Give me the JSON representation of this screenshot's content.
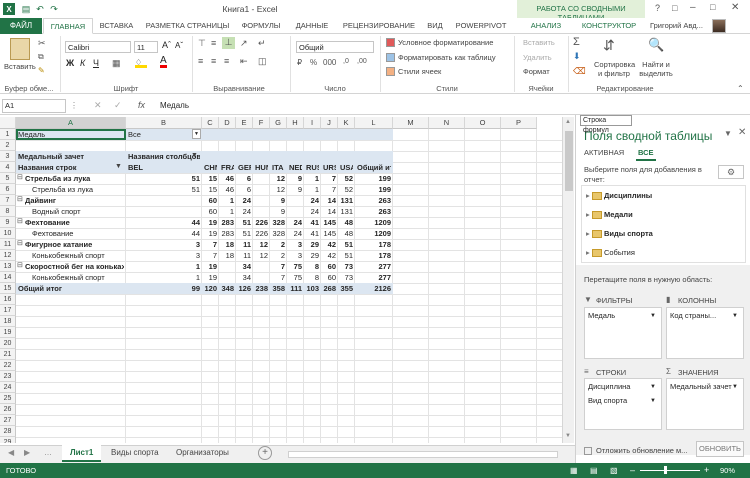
{
  "app": {
    "title": "Книга1 - Excel",
    "context_tab": "РАБОТА СО СВОДНЫМИ ТАБЛИЦАМИ",
    "user": "Григорий Авд..."
  },
  "tabs": [
    "ФАЙЛ",
    "ГЛАВНАЯ",
    "ВСТАВКА",
    "РАЗМЕТКА СТРАНИЦЫ",
    "ФОРМУЛЫ",
    "ДАННЫЕ",
    "РЕЦЕНЗИРОВАНИЕ",
    "ВИД",
    "POWERPIVOT",
    "АНАЛИЗ",
    "КОНСТРУКТОР"
  ],
  "ribbon": {
    "paste": "Вставить",
    "font_name": "Calibri",
    "font_size": "11",
    "number_format": "Общий",
    "cond_format": "Условное форматирование",
    "format_table": "Форматировать как таблицу",
    "cell_styles": "Стили ячеек",
    "insert": "Вставить",
    "delete": "Удалить",
    "format": "Формат",
    "sort": "Сортировка и фильтр",
    "find": "Найти и выделить",
    "groups": [
      "Буфер обме...",
      "Шрифт",
      "Выравнивание",
      "Число",
      "Стили",
      "Ячейки",
      "Редактирование"
    ]
  },
  "formula_bar": {
    "name_box": "A1",
    "fx": "fx",
    "value": "Медаль",
    "tooltip": "Строка формул"
  },
  "columns": [
    "A",
    "B",
    "C",
    "D",
    "E",
    "F",
    "G",
    "H",
    "I",
    "J",
    "K",
    "L",
    "M",
    "N",
    "O",
    "P"
  ],
  "rows": [
    {
      "n": "1",
      "a": "Медаль",
      "b": "Все"
    },
    {
      "n": "2"
    },
    {
      "n": "3",
      "a": "Медальный зачет",
      "b": "Названия столбцов"
    },
    {
      "n": "4",
      "a": "Названия строк",
      "b": "BEL",
      "vals": [
        "CHN",
        "FRA",
        "GER",
        "HUN",
        "ITA",
        "NED",
        "RUS",
        "URS",
        "USA",
        "Общий итог"
      ]
    },
    {
      "n": "5",
      "a": "Стрельба из лука",
      "vals": [
        "51",
        "15",
        "46",
        "6",
        "",
        "12",
        "9",
        "1",
        "7",
        "52",
        "199"
      ]
    },
    {
      "n": "6",
      "a": "Стрельба из лука",
      "vals": [
        "51",
        "15",
        "46",
        "6",
        "",
        "12",
        "9",
        "1",
        "7",
        "52",
        "199"
      ]
    },
    {
      "n": "7",
      "a": "Дайвинг",
      "vals": [
        "",
        "60",
        "1",
        "24",
        "",
        "9",
        "",
        "24",
        "14",
        "131",
        "263"
      ]
    },
    {
      "n": "8",
      "a": "Водный спорт",
      "vals": [
        "",
        "60",
        "1",
        "24",
        "",
        "9",
        "",
        "24",
        "14",
        "131",
        "263"
      ]
    },
    {
      "n": "9",
      "a": "Фехтование",
      "vals": [
        "44",
        "19",
        "283",
        "51",
        "226",
        "328",
        "24",
        "41",
        "145",
        "48",
        "1209"
      ]
    },
    {
      "n": "10",
      "a": "Фехтование",
      "vals": [
        "44",
        "19",
        "283",
        "51",
        "226",
        "328",
        "24",
        "41",
        "145",
        "48",
        "1209"
      ]
    },
    {
      "n": "11",
      "a": "Фигурное катание",
      "vals": [
        "3",
        "7",
        "18",
        "11",
        "12",
        "2",
        "3",
        "29",
        "42",
        "51",
        "178"
      ]
    },
    {
      "n": "12",
      "a": "Конькобежный спорт",
      "vals": [
        "3",
        "7",
        "18",
        "11",
        "12",
        "2",
        "3",
        "29",
        "42",
        "51",
        "178"
      ]
    },
    {
      "n": "13",
      "a": "Скоростной бег на коньках",
      "vals": [
        "1",
        "19",
        "",
        "34",
        "",
        "7",
        "75",
        "8",
        "60",
        "73",
        "277"
      ]
    },
    {
      "n": "14",
      "a": "Конькобежный спорт",
      "vals": [
        "1",
        "19",
        "",
        "34",
        "",
        "7",
        "75",
        "8",
        "60",
        "73",
        "277"
      ]
    },
    {
      "n": "15",
      "a": "Общий итог",
      "vals": [
        "99",
        "120",
        "348",
        "126",
        "238",
        "358",
        "111",
        "103",
        "268",
        "355",
        "2126"
      ]
    }
  ],
  "sheets": [
    "Лист1",
    "Виды спорта",
    "Организаторы"
  ],
  "status": {
    "ready": "ГОТОВО",
    "zoom": "90%"
  },
  "pane": {
    "title": "Поля сводной таблицы",
    "tab_active": "АКТИВНАЯ",
    "tab_all": "ВСЕ",
    "choose_label": "Выберите поля для добавления в отчет:",
    "fields": [
      "Дисциплины",
      "Медали",
      "Виды спорта",
      "События"
    ],
    "drag_label": "Перетащите поля в нужную область:",
    "filters": "ФИЛЬТРЫ",
    "columns": "КОЛОННЫ",
    "rows": "СТРОКИ",
    "values": "ЗНАЧЕНИЯ",
    "filter_item": "Медаль",
    "column_item": "Код страны...",
    "row_items": [
      "Дисциплина",
      "Вид спорта"
    ],
    "value_item": "Медальный зачет",
    "defer": "Отложить обновление м...",
    "update": "ОБНОВИТЬ"
  },
  "colors": {
    "excel_green": "#217346",
    "pivot_header": "#dce6f1"
  }
}
